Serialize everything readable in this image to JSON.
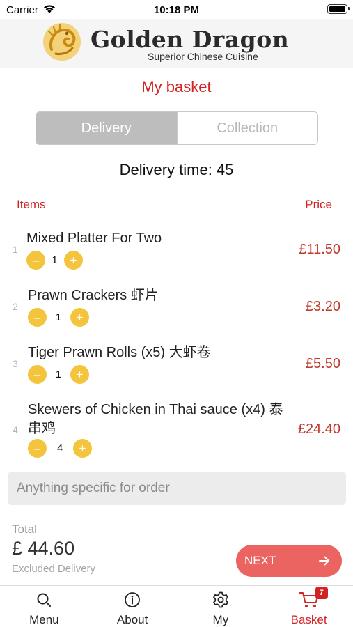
{
  "status_bar": {
    "carrier": "Carrier",
    "time": "10:18 PM"
  },
  "brand": {
    "name": "Golden Dragon",
    "tagline": "Superior Chinese Cuisine"
  },
  "page_title": "My basket",
  "fulfilment": {
    "options": [
      "Delivery",
      "Collection"
    ],
    "selected": "Delivery"
  },
  "delivery_time": "Delivery time: 45",
  "columns": {
    "items": "Items",
    "price": "Price"
  },
  "items": [
    {
      "index": "1",
      "name": "Mixed Platter For Two",
      "qty": "1",
      "price": "£11.50"
    },
    {
      "index": "2",
      "name": "Prawn Crackers 虾片",
      "qty": "1",
      "price": "£3.20"
    },
    {
      "index": "3",
      "name": "Tiger Prawn Rolls (x5) 大虾卷",
      "qty": "1",
      "price": "£5.50"
    },
    {
      "index": "4",
      "name": "Skewers of Chicken in Thai sauce (x4) 泰串鸡",
      "qty": "4",
      "price": "£24.40"
    }
  ],
  "qty_controls": {
    "minus": "–",
    "plus": "+"
  },
  "note": {
    "placeholder": "Anything specific for order",
    "value": ""
  },
  "total": {
    "label": "Total",
    "amount": "£ 44.60",
    "note": "Excluded Delivery"
  },
  "next_button": {
    "label": "NEXT",
    "icon": "arrow-right-icon"
  },
  "tabs": [
    {
      "label": "Menu",
      "icon": "search-icon"
    },
    {
      "label": "About",
      "icon": "info-icon"
    },
    {
      "label": "My",
      "icon": "gear-icon"
    },
    {
      "label": "Basket",
      "icon": "cart-icon",
      "badge": "7",
      "active": true
    }
  ],
  "colors": {
    "accent": "#d32222",
    "price": "#c0392b",
    "qty_button": "#f5c43d",
    "next_button": "#ec6461"
  }
}
